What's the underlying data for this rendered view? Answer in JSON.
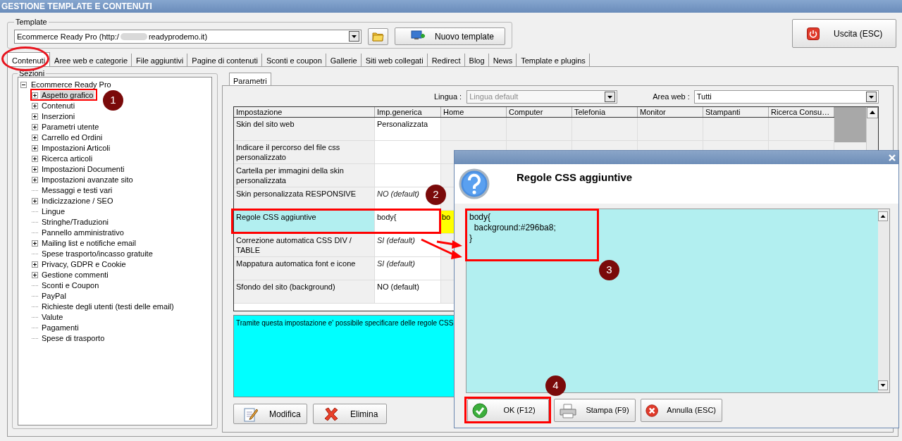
{
  "window": {
    "title": "GESTIONE TEMPLATE E CONTENUTI"
  },
  "template": {
    "legend": "Template",
    "value_start": "Ecommerce Ready Pro (http:/",
    "value_end": "readyprodemo.it)",
    "new_button": "Nuovo template"
  },
  "exit_button": "Uscita (ESC)",
  "tabs": [
    {
      "label": "Contenuti",
      "selected": true
    },
    {
      "label": "Aree web e categorie",
      "selected": false
    },
    {
      "label": "File aggiuntivi",
      "selected": false
    },
    {
      "label": "Pagine di contenuti",
      "selected": false
    },
    {
      "label": "Sconti e coupon",
      "selected": false
    },
    {
      "label": "Gallerie",
      "selected": false
    },
    {
      "label": "Siti web collegati",
      "selected": false
    },
    {
      "label": "Redirect",
      "selected": false
    },
    {
      "label": "Blog",
      "selected": false
    },
    {
      "label": "News",
      "selected": false
    },
    {
      "label": "Template e plugins",
      "selected": false
    }
  ],
  "sections": {
    "legend": "Sezioni",
    "tree": [
      {
        "label": "Ecommerce Ready Pro",
        "expanded": true,
        "selected": false,
        "children": [
          {
            "label": "Aspetto grafico",
            "expandable": true,
            "selected": true
          },
          {
            "label": "Contenuti",
            "expandable": true,
            "selected": false
          },
          {
            "label": "Inserzioni",
            "expandable": true,
            "selected": false
          },
          {
            "label": "Parametri utente",
            "expandable": true,
            "selected": false
          },
          {
            "label": "Carrello ed Ordini",
            "expandable": true,
            "selected": false
          },
          {
            "label": "Impostazioni Articoli",
            "expandable": true,
            "selected": false
          },
          {
            "label": "Ricerca articoli",
            "expandable": true,
            "selected": false
          },
          {
            "label": "Impostazioni Documenti",
            "expandable": true,
            "selected": false
          },
          {
            "label": "Impostazioni avanzate sito",
            "expandable": true,
            "selected": false
          },
          {
            "label": "Messaggi e testi vari",
            "expandable": false,
            "selected": false
          },
          {
            "label": "Indicizzazione / SEO",
            "expandable": true,
            "selected": false
          },
          {
            "label": "Lingue",
            "expandable": false,
            "selected": false
          },
          {
            "label": "Stringhe/Traduzioni",
            "expandable": false,
            "selected": false
          },
          {
            "label": "Pannello amministrativo",
            "expandable": false,
            "selected": false
          },
          {
            "label": "Mailing list e notifiche email",
            "expandable": true,
            "selected": false
          },
          {
            "label": "Spese trasporto/incasso gratuite",
            "expandable": false,
            "selected": false
          },
          {
            "label": "Privacy, GDPR e Cookie",
            "expandable": true,
            "selected": false
          },
          {
            "label": "Gestione commenti",
            "expandable": true,
            "selected": false
          },
          {
            "label": "Sconti e Coupon",
            "expandable": false,
            "selected": false
          },
          {
            "label": "PayPal",
            "expandable": false,
            "selected": false
          },
          {
            "label": "Richieste degli utenti (testi delle email)",
            "expandable": false,
            "selected": false
          },
          {
            "label": "Valute",
            "expandable": false,
            "selected": false
          },
          {
            "label": "Pagamenti",
            "expandable": false,
            "selected": false
          },
          {
            "label": "Spese di trasporto",
            "expandable": false,
            "selected": false
          }
        ]
      }
    ]
  },
  "parameters": {
    "tab": "Parametri",
    "language_label": "Lingua :",
    "language_value": "Lingua default",
    "language_disabled": true,
    "area_label": "Area web :",
    "area_value": "Tutti",
    "table": {
      "columns": [
        "Impostazione",
        "Imp.generica",
        "Home",
        "Computer",
        "Telefonia",
        "Monitor",
        "Stampanti",
        "Ricerca Consu…"
      ],
      "rows": [
        {
          "setting": "Skin del sito web",
          "generic": "Personalizzata",
          "inherited": false,
          "selected": false
        },
        {
          "setting": "Indicare il percorso del file css personalizzato",
          "selected": false
        },
        {
          "setting": "Cartella per immagini della skin personalizzata",
          "selected": false
        },
        {
          "setting": "Skin personalizzata RESPONSIVE",
          "generic": "NO (default)",
          "inherited": true,
          "selected": false
        },
        {
          "setting": "Regole CSS aggiuntive",
          "generic": "body{",
          "home": "bo",
          "inherited": false,
          "selected": true
        },
        {
          "setting": "Correzione automatica CSS DIV / TABLE",
          "generic": "SI (default)",
          "inherited": true,
          "selected": false
        },
        {
          "setting": "Mappatura automatica font e icone",
          "generic": "SI (default)",
          "inherited": true,
          "selected": false
        },
        {
          "setting": "Sfondo del sito (background)",
          "generic": "NO (default)",
          "inherited": false,
          "selected": false
        }
      ]
    },
    "description": "Tramite questa impostazione e' possibile specificare delle regole CSS",
    "buttons": [
      {
        "label": "Modifica",
        "kind": "edit"
      },
      {
        "label": "Elimina",
        "kind": "delete"
      }
    ]
  },
  "dialog": {
    "title": "Regole CSS aggiuntive",
    "code": "body{\n  background:#296ba8;\n}",
    "buttons": [
      {
        "label": "OK (F12)",
        "kind": "ok"
      },
      {
        "label": "Stampa (F9)",
        "kind": "print"
      },
      {
        "label": "Annulla (ESC)",
        "kind": "cancel"
      }
    ]
  },
  "markers": [
    "1",
    "2",
    "3",
    "4"
  ]
}
